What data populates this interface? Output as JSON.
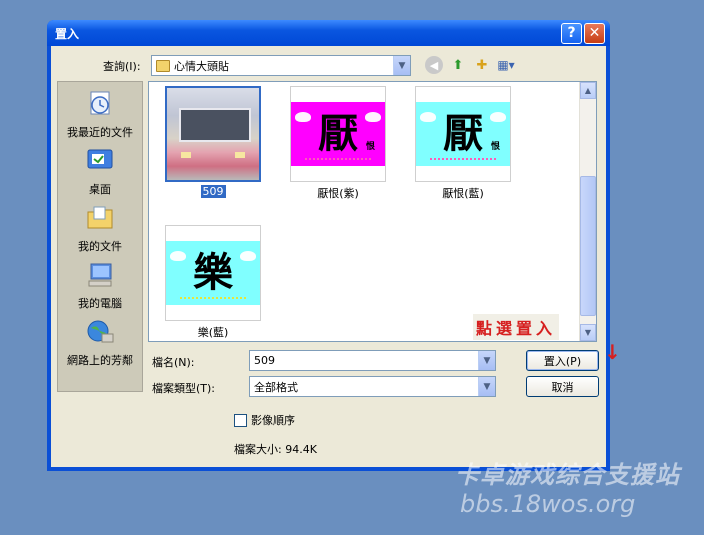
{
  "dialog": {
    "title": "置入",
    "help": "?",
    "close": "✕"
  },
  "lookin": {
    "label": "查詢(I):",
    "value": "心情大頭貼"
  },
  "toolbar_icons": [
    "back-icon",
    "up-folder-icon",
    "new-folder-icon",
    "view-menu-icon"
  ],
  "places": [
    {
      "label": "我最近的文件",
      "icon": "recent-documents-icon"
    },
    {
      "label": "桌面",
      "icon": "desktop-icon"
    },
    {
      "label": "我的文件",
      "icon": "my-documents-icon"
    },
    {
      "label": "我的電腦",
      "icon": "my-computer-icon"
    },
    {
      "label": "網路上的芳鄰",
      "icon": "network-places-icon"
    }
  ],
  "files": [
    {
      "name": "509",
      "selected": true,
      "thumb_char": ""
    },
    {
      "name": "厭恨(紫)",
      "thumb_char": "厭",
      "thumb_small": "恨",
      "bg": "#ff00ff"
    },
    {
      "name": "厭恨(藍)",
      "thumb_char": "厭",
      "thumb_small": "恨",
      "bg": "#80ffff"
    },
    {
      "name": "樂(藍)",
      "thumb_char": "樂",
      "bg": "#80ffff"
    }
  ],
  "annotation": {
    "text": "點選置入",
    "arrow": "↓"
  },
  "filename": {
    "label": "檔名(N):",
    "value": "509"
  },
  "filetype": {
    "label": "檔案類型(T):",
    "value": "全部格式"
  },
  "buttons": {
    "open": "置入(P)",
    "cancel": "取消"
  },
  "sequence": {
    "label": "影像順序",
    "checked": false
  },
  "filesize": {
    "text": "檔案大小: 94.4K"
  },
  "watermark": {
    "line1": "卡卓游戏综合支援站",
    "line2": "bbs.18wos.org"
  },
  "colors": {
    "desktop": "#6a8fbf",
    "title": "#0a56e0",
    "selection": "#316ac5",
    "annotation": "#d62020"
  }
}
